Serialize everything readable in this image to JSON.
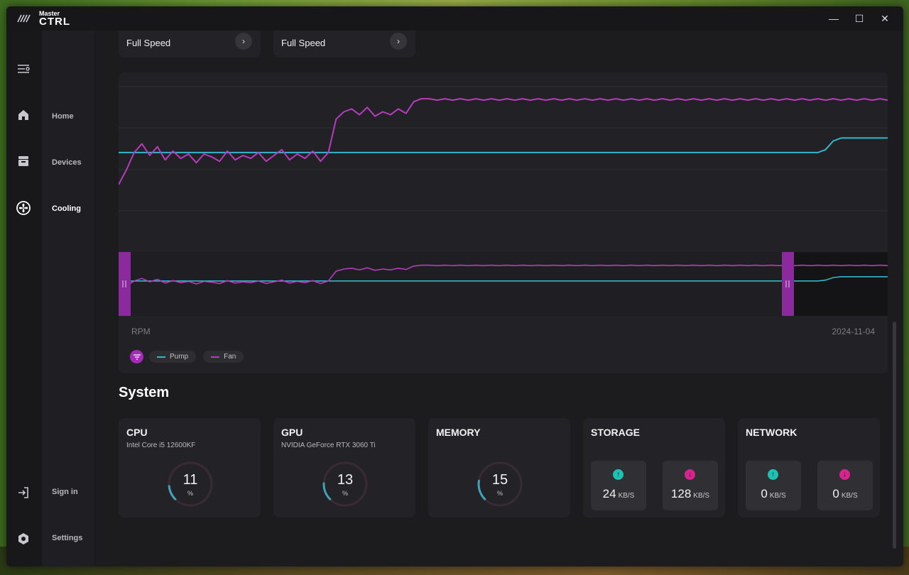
{
  "app": {
    "logo_small": "Master",
    "logo_big": "CTRL"
  },
  "window_controls": {
    "minimize": "—",
    "maximize": "☐",
    "close": "✕"
  },
  "nav": {
    "home": "Home",
    "devices": "Devices",
    "cooling": "Cooling",
    "sign_in": "Sign in",
    "settings": "Settings"
  },
  "speed_cards": [
    {
      "label": "Full Speed",
      "arrow": "›"
    },
    {
      "label": "Full Speed",
      "arrow": "›"
    }
  ],
  "chart": {
    "y_unit_label": "RPM",
    "date_label": "2024-11-04",
    "legend": {
      "pump": "Pump",
      "fan": "Fan"
    },
    "colors": {
      "pump": "#33b6cc",
      "fan": "#b63bbd",
      "handle": "#8a2a9c"
    }
  },
  "chart_data": {
    "type": "line",
    "xlabel": "",
    "ylabel": "RPM",
    "series": [
      {
        "name": "Pump",
        "values": [
          0.62,
          0.62,
          0.62,
          0.62,
          0.62,
          0.62,
          0.62,
          0.62,
          0.62,
          0.62,
          0.62,
          0.62,
          0.62,
          0.62,
          0.62,
          0.62,
          0.62,
          0.62,
          0.62,
          0.62,
          0.62,
          0.62,
          0.62,
          0.62,
          0.62,
          0.62,
          0.62,
          0.62,
          0.62,
          0.62,
          0.62,
          0.62,
          0.62,
          0.62,
          0.62,
          0.62,
          0.62,
          0.62,
          0.62,
          0.62,
          0.62,
          0.62,
          0.62,
          0.62,
          0.62,
          0.62,
          0.62,
          0.62,
          0.62,
          0.62,
          0.62,
          0.62,
          0.62,
          0.62,
          0.62,
          0.62,
          0.62,
          0.62,
          0.62,
          0.62,
          0.62,
          0.62,
          0.62,
          0.62,
          0.62,
          0.62,
          0.62,
          0.62,
          0.62,
          0.62,
          0.62,
          0.62,
          0.62,
          0.62,
          0.62,
          0.62,
          0.62,
          0.62,
          0.62,
          0.62,
          0.62,
          0.62,
          0.62,
          0.62,
          0.62,
          0.62,
          0.62,
          0.62,
          0.62,
          0.62,
          0.62,
          0.64,
          0.7,
          0.72,
          0.72,
          0.72,
          0.72,
          0.72,
          0.72,
          0.72
        ]
      },
      {
        "name": "Fan",
        "values": [
          0.4,
          0.5,
          0.62,
          0.68,
          0.6,
          0.66,
          0.57,
          0.63,
          0.58,
          0.61,
          0.55,
          0.61,
          0.59,
          0.56,
          0.63,
          0.57,
          0.6,
          0.58,
          0.62,
          0.56,
          0.6,
          0.64,
          0.57,
          0.61,
          0.58,
          0.63,
          0.56,
          0.62,
          0.85,
          0.9,
          0.92,
          0.88,
          0.93,
          0.87,
          0.9,
          0.88,
          0.92,
          0.89,
          0.97,
          0.99,
          0.99,
          0.98,
          0.99,
          0.98,
          0.99,
          0.98,
          0.99,
          0.98,
          0.99,
          0.98,
          0.99,
          0.98,
          0.99,
          0.98,
          0.99,
          0.98,
          0.99,
          0.98,
          0.99,
          0.98,
          0.99,
          0.98,
          0.99,
          0.98,
          0.99,
          0.98,
          0.99,
          0.98,
          0.99,
          0.98,
          0.99,
          0.98,
          0.99,
          0.98,
          0.99,
          0.98,
          0.99,
          0.98,
          0.99,
          0.98,
          0.99,
          0.98,
          0.99,
          0.98,
          0.99,
          0.98,
          0.99,
          0.98,
          0.99,
          0.98,
          0.99,
          0.98,
          0.99,
          0.98,
          0.99,
          0.98,
          0.99,
          0.98,
          0.99,
          0.98
        ]
      }
    ]
  },
  "system": {
    "title": "System",
    "cpu": {
      "title": "CPU",
      "subtitle": "Intel Core i5 12600KF",
      "value": "11",
      "unit": "%",
      "percent": 11
    },
    "gpu": {
      "title": "GPU",
      "subtitle": "NVIDIA GeForce RTX 3060 Ti",
      "value": "13",
      "unit": "%",
      "percent": 13
    },
    "memory": {
      "title": "MEMORY",
      "value": "15",
      "unit": "%",
      "percent": 15
    },
    "storage": {
      "title": "STORAGE",
      "up_value": "24",
      "up_unit": "KB/S",
      "down_value": "128",
      "down_unit": "KB/S"
    },
    "network": {
      "title": "NETWORK",
      "up_value": "0",
      "up_unit": "KB/S",
      "down_value": "0",
      "down_unit": "KB/S"
    },
    "colors": {
      "up": "#1ec2b3",
      "down": "#d6248f",
      "gauge_fill": "#3fa3b8",
      "gauge_track": "#3a2a33"
    }
  }
}
